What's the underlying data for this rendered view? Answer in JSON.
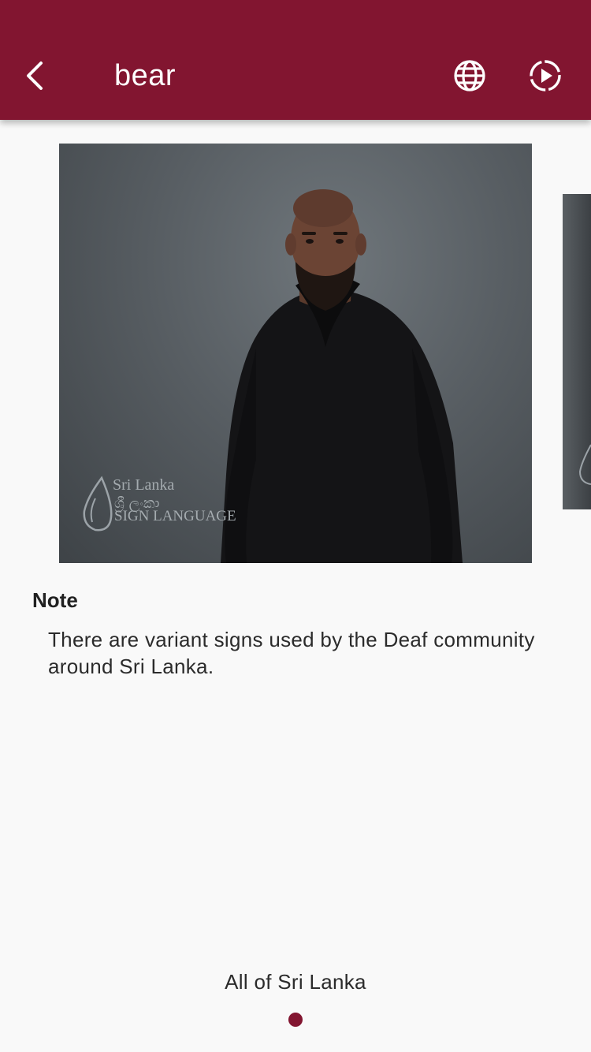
{
  "app_bar": {
    "title": "bear",
    "background_color": "#821530",
    "icons": {
      "back": "chevron-left-icon",
      "globe": "globe-icon",
      "play": "play-circle-icon"
    }
  },
  "video": {
    "watermark_icon": "sri-lanka-sign-language-logo",
    "watermark_lines": [
      "Sri Lanka",
      "ශ්‍රී ලංකා",
      "SIGN LANGUAGE"
    ]
  },
  "note": {
    "heading": "Note",
    "text": "There are variant signs used by the Deaf community around Sri Lanka."
  },
  "region": {
    "label": "All of Sri Lanka"
  },
  "pager": {
    "current_page": 1,
    "total_pages": 1,
    "accent_color": "#821530"
  }
}
